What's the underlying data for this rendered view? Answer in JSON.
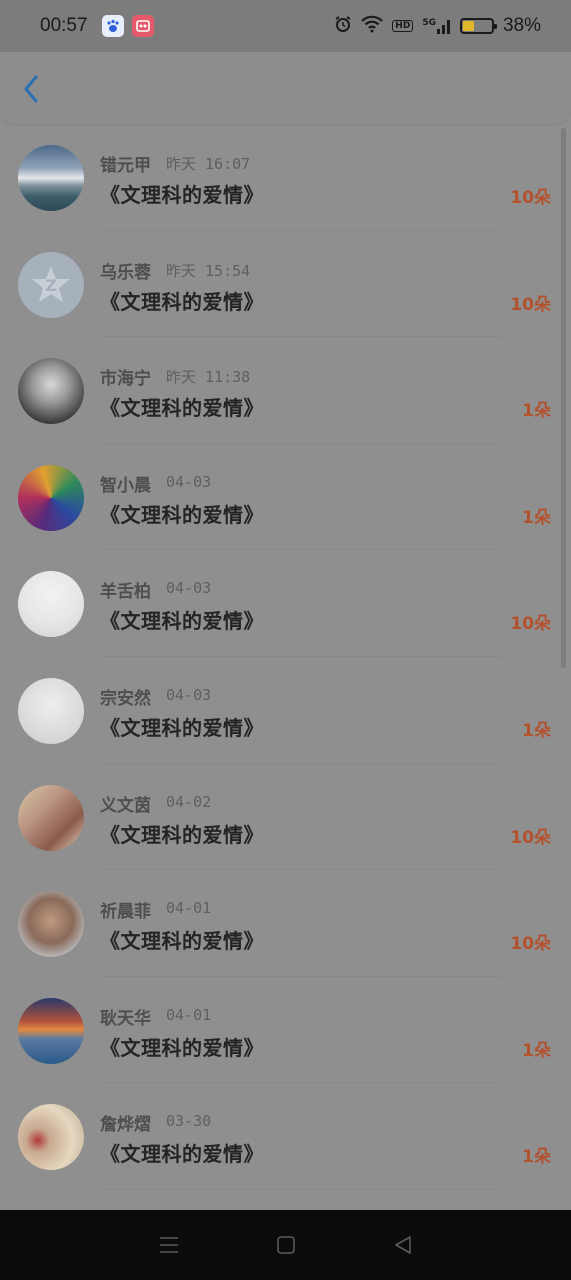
{
  "status_bar": {
    "time": "00:57",
    "apps": [
      "baidu-app-icon",
      "video-app-icon"
    ],
    "network": "5G",
    "hd": "HD",
    "battery_level": 0.38,
    "battery_text": "38%"
  },
  "header": {
    "back_icon": "chevron-left-icon",
    "accent_color": "#2a6fb4"
  },
  "items": [
    {
      "name": "错元甲",
      "time": "昨天 16:07",
      "title": "《文理科的爱情》",
      "count": "10朵",
      "avatar": "landscape"
    },
    {
      "name": "乌乐蓉",
      "time": "昨天 15:54",
      "title": "《文理科的爱情》",
      "count": "10朵",
      "avatar": "default"
    },
    {
      "name": "市海宁",
      "time": "昨天 11:38",
      "title": "《文理科的爱情》",
      "count": "1朵",
      "avatar": "portrait"
    },
    {
      "name": "智小晨",
      "time": "04-03",
      "title": "《文理科的爱情》",
      "count": "1朵",
      "avatar": "gradient"
    },
    {
      "name": "羊舌柏",
      "time": "04-03",
      "title": "《文理科的爱情》",
      "count": "10朵",
      "avatar": "sketch"
    },
    {
      "name": "宗安然",
      "time": "04-03",
      "title": "《文理科的爱情》",
      "count": "1朵",
      "avatar": "sketch2"
    },
    {
      "name": "义文茵",
      "time": "04-02",
      "title": "《文理科的爱情》",
      "count": "10朵",
      "avatar": "photo"
    },
    {
      "name": "祈晨菲",
      "time": "04-01",
      "title": "《文理科的爱情》",
      "count": "10朵",
      "avatar": "photo2"
    },
    {
      "name": "耿天华",
      "time": "04-01",
      "title": "《文理科的爱情》",
      "count": "1朵",
      "avatar": "sunset"
    },
    {
      "name": "詹烨熠",
      "time": "03-30",
      "title": "《文理科的爱情》",
      "count": "1朵",
      "avatar": "hearts"
    }
  ],
  "nav_bar": {
    "menu_icon": "menu-icon",
    "home_icon": "home-square-icon",
    "back_icon": "back-triangle-icon"
  }
}
